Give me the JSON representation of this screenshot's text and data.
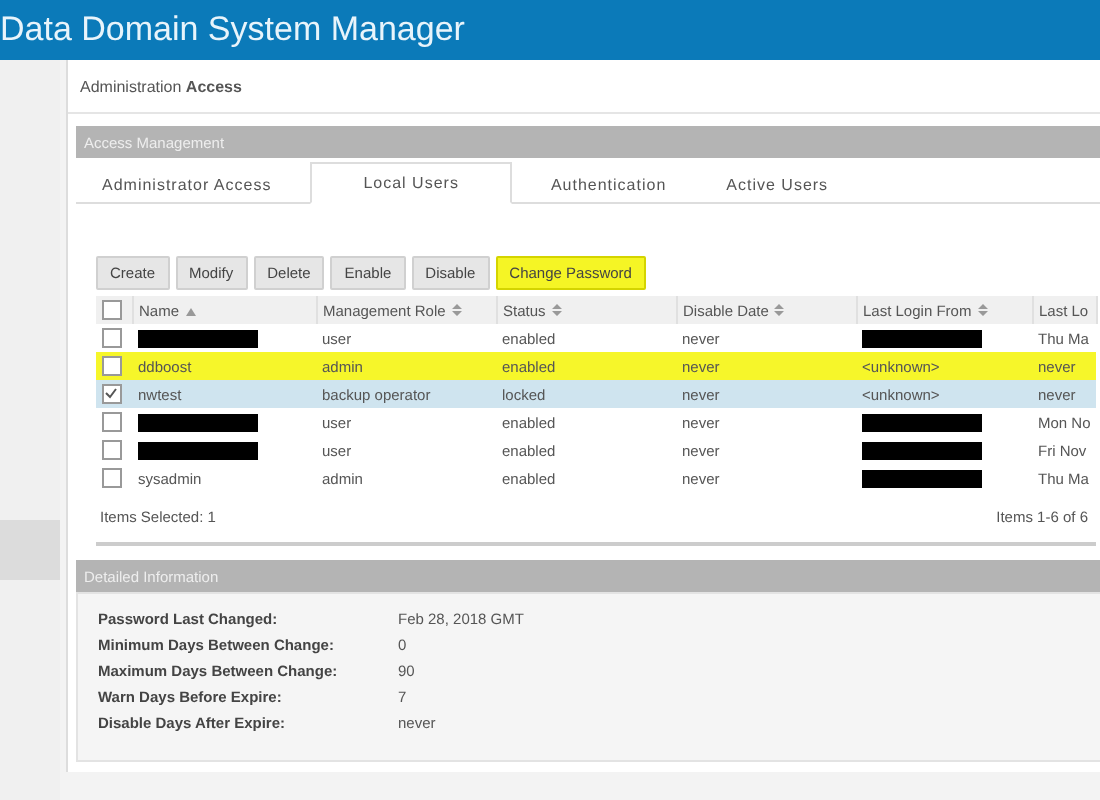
{
  "header": {
    "title": "Data Domain System Manager"
  },
  "breadcrumb": {
    "parent": "Administration",
    "current": "Access"
  },
  "panel": {
    "title": "Access Management"
  },
  "tabs": [
    {
      "label": "Administrator Access",
      "selected": false
    },
    {
      "label": "Local Users",
      "selected": true
    },
    {
      "label": "Authentication",
      "selected": false
    },
    {
      "label": "Active Users",
      "selected": false
    }
  ],
  "toolbar": [
    {
      "label": "Create",
      "highlighted": false
    },
    {
      "label": "Modify",
      "highlighted": false
    },
    {
      "label": "Delete",
      "highlighted": false
    },
    {
      "label": "Enable",
      "highlighted": false
    },
    {
      "label": "Disable",
      "highlighted": false
    },
    {
      "label": "Change Password",
      "highlighted": true
    }
  ],
  "table": {
    "columns": [
      {
        "label": "Name",
        "kind": "sorted"
      },
      {
        "label": "Management Role",
        "kind": "sortable"
      },
      {
        "label": "Status",
        "kind": "sortable"
      },
      {
        "label": "Disable Date",
        "kind": "sortable"
      },
      {
        "label": "Last Login From",
        "kind": "sortable"
      },
      {
        "label": "Last Lo",
        "kind": "plain"
      }
    ],
    "all_checked": false,
    "rows": [
      {
        "checked": false,
        "selected": false,
        "highlighted": false,
        "cells": [
          {
            "kind": "redacted"
          },
          {
            "kind": "text",
            "text": "user"
          },
          {
            "kind": "text",
            "text": "enabled"
          },
          {
            "kind": "text",
            "text": "never"
          },
          {
            "kind": "redacted"
          },
          {
            "kind": "text",
            "text": "Thu Ma"
          }
        ]
      },
      {
        "checked": false,
        "selected": false,
        "highlighted": true,
        "cells": [
          {
            "kind": "text",
            "text": "ddboost"
          },
          {
            "kind": "text",
            "text": "admin"
          },
          {
            "kind": "text",
            "text": "enabled"
          },
          {
            "kind": "text",
            "text": "never"
          },
          {
            "kind": "text",
            "text": "<unknown>"
          },
          {
            "kind": "text",
            "text": "never"
          }
        ]
      },
      {
        "checked": true,
        "selected": true,
        "highlighted": false,
        "cells": [
          {
            "kind": "text",
            "text": "nwtest"
          },
          {
            "kind": "text",
            "text": "backup operator"
          },
          {
            "kind": "text",
            "text": "locked"
          },
          {
            "kind": "text",
            "text": "never"
          },
          {
            "kind": "text",
            "text": "<unknown>"
          },
          {
            "kind": "text",
            "text": "never"
          }
        ]
      },
      {
        "checked": false,
        "selected": false,
        "highlighted": false,
        "cells": [
          {
            "kind": "redacted"
          },
          {
            "kind": "text",
            "text": "user"
          },
          {
            "kind": "text",
            "text": "enabled"
          },
          {
            "kind": "text",
            "text": "never"
          },
          {
            "kind": "redacted"
          },
          {
            "kind": "text",
            "text": "Mon No"
          }
        ]
      },
      {
        "checked": false,
        "selected": false,
        "highlighted": false,
        "cells": [
          {
            "kind": "redacted"
          },
          {
            "kind": "text",
            "text": "user"
          },
          {
            "kind": "text",
            "text": "enabled"
          },
          {
            "kind": "text",
            "text": "never"
          },
          {
            "kind": "redacted"
          },
          {
            "kind": "text",
            "text": "Fri Nov"
          }
        ]
      },
      {
        "checked": false,
        "selected": false,
        "highlighted": false,
        "cells": [
          {
            "kind": "text",
            "text": "sysadmin"
          },
          {
            "kind": "text",
            "text": "admin"
          },
          {
            "kind": "text",
            "text": "enabled"
          },
          {
            "kind": "text",
            "text": "never"
          },
          {
            "kind": "redacted"
          },
          {
            "kind": "text",
            "text": "Thu Ma"
          }
        ]
      }
    ],
    "selection_count": "Items Selected: 1",
    "range": "Items 1-6 of 6"
  },
  "details": {
    "title": "Detailed Information",
    "fields": [
      {
        "label": "Password Last Changed:",
        "value": "Feb 28, 2018 GMT"
      },
      {
        "label": "Minimum Days Between Change:",
        "value": "0"
      },
      {
        "label": "Maximum Days Between Change:",
        "value": "90"
      },
      {
        "label": "Warn Days Before Expire:",
        "value": "7"
      },
      {
        "label": "Disable Days After Expire:",
        "value": "never"
      }
    ]
  }
}
